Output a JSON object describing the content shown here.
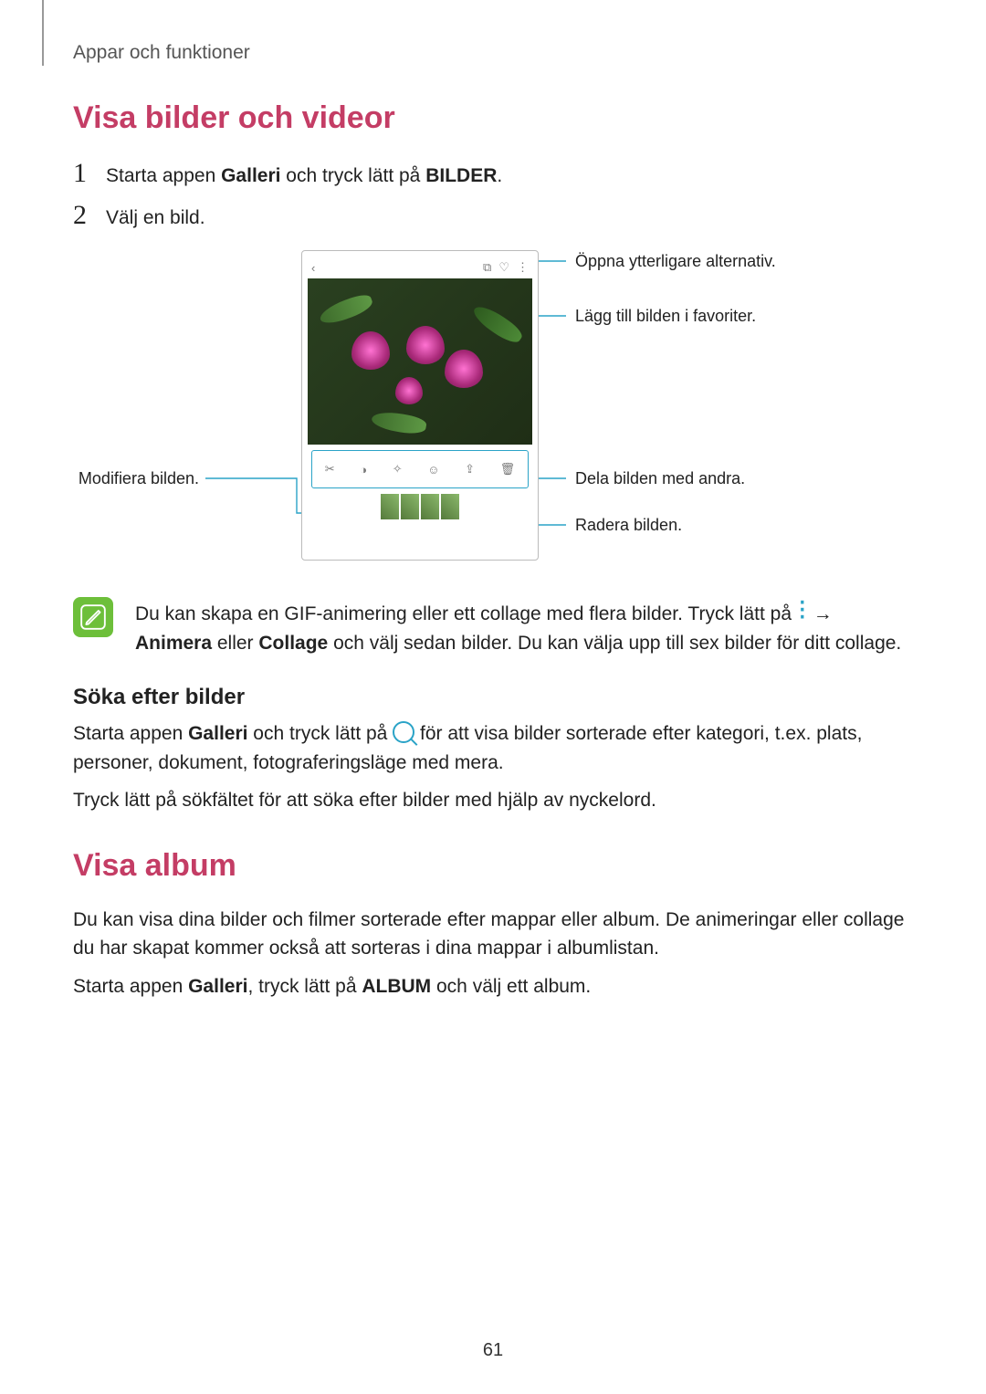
{
  "breadcrumb": "Appar och funktioner",
  "section1": {
    "title": "Visa bilder och videor",
    "steps": {
      "n1": "1",
      "t1_a": "Starta appen ",
      "t1_b": "Galleri",
      "t1_c": " och tryck lätt på ",
      "t1_d": "BILDER",
      "t1_e": ".",
      "n2": "2",
      "t2": "Välj en bild."
    }
  },
  "callouts": {
    "more": "Öppna ytterligare alternativ.",
    "fav": "Lägg till bilden i favoriter.",
    "share": "Dela bilden med andra.",
    "delete": "Radera bilden.",
    "edit": "Modifiera bilden."
  },
  "note": {
    "pre": "Du kan skapa en GIF-animering eller ett collage med flera bilder. Tryck lätt på ",
    "arrow": " →",
    "line2a": "Animera",
    "line2b": " eller ",
    "line2c": "Collage",
    "line2d": " och välj sedan bilder. Du kan välja upp till sex bilder för ditt collage."
  },
  "section2": {
    "title": "Söka efter bilder",
    "p1a": "Starta appen ",
    "p1b": "Galleri",
    "p1c": " och tryck lätt på ",
    "p1d": " för att visa bilder sorterade efter kategori, t.ex. plats, personer, dokument, fotograferingsläge med mera.",
    "p2": "Tryck lätt på sökfältet för att söka efter bilder med hjälp av nyckelord."
  },
  "section3": {
    "title": "Visa album",
    "p1": "Du kan visa dina bilder och filmer sorterade efter mappar eller album. De animeringar eller collage du har skapat kommer också att sorteras i dina mappar i albumlistan.",
    "p2a": "Starta appen ",
    "p2b": "Galleri",
    "p2c": ", tryck lätt på ",
    "p2d": "ALBUM",
    "p2e": " och välj ett album."
  },
  "page_number": "61"
}
